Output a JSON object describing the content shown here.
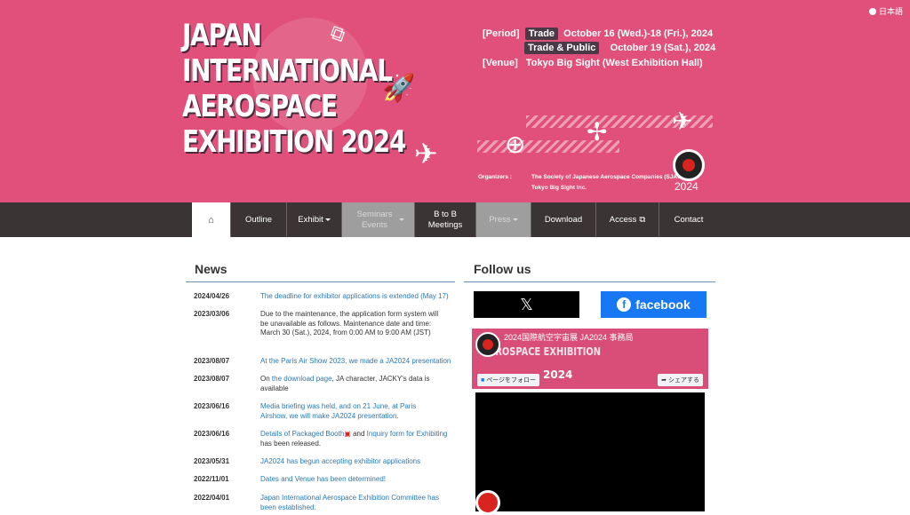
{
  "hero": {
    "language": "日本語",
    "title_lines": [
      "JAPAN",
      "INTERNATIONAL",
      "AEROSPACE",
      "EXHIBITION 2024"
    ],
    "period_label": "[Period]",
    "trade_tag": "Trade",
    "trade_dates": "October 16 (Wed.)-18 (Fri.), 2024",
    "public_tag": "Trade & Public",
    "public_date": "October 19 (Sat.), 2024",
    "venue_label": "[Venue]",
    "venue": "Tokyo Big Sight (West Exhibition Hall)",
    "organizers_label": "Organizers :",
    "organizer_1": "The Society of Japanese Aerospace Companies (SJAC)",
    "organizer_2": "Tokyo Big Sight Inc.",
    "emblem_year": "2024",
    "accent_color": "#e0507a"
  },
  "nav": {
    "items": [
      "Outline",
      "Exhibit",
      "Seminars Events",
      "B to B Meetings",
      "Press",
      "Download",
      "Access",
      "Contact"
    ]
  },
  "news": {
    "heading": "News",
    "items": [
      {
        "date": "2024/04/26",
        "text": "The deadline for exhibitor applications is extended (May 17)"
      },
      {
        "date": "2023/03/06",
        "text": "Due to the maintenance, the application form system will be unavailable as follows. Maintenance date and time: March 30 (Sat.), 2024, from 0:00 AM to 9:00 AM (JST)"
      },
      {
        "date": "2023/08/07",
        "text": "At the Paris Air Show 2023, we made a JA2024 presentation"
      },
      {
        "date": "2023/08/07",
        "text_a": "On ",
        "text_link": "the download page",
        "text_b": ", JA character, JACKY's data is available"
      },
      {
        "date": "2023/06/16",
        "text": "Media briefing was held, and on 21 June, at Paris Airshow, we will make JA2024 presentation."
      },
      {
        "date": "2023/06/16",
        "text_a": "Details of Packaged Booth",
        "text_b": " and ",
        "text_c": "Inquiry form for Exhibiting",
        "text_d": " has been released."
      },
      {
        "date": "2023/05/31",
        "text": "JA2024 has begun accepting exhibitor applications"
      },
      {
        "date": "2022/11/01",
        "text": "Dates and Venue has been determined!"
      },
      {
        "date": "2022/04/01",
        "text": "Japan International Aerospace Exhibition Committee has been established."
      }
    ]
  },
  "follow": {
    "heading": "Follow us",
    "x_label": "𝕏",
    "facebook_label": "facebook",
    "fb_page_name": "2024国際航空宇宙展 JA2024 事務局",
    "fb_follow": "ページをフォロー",
    "fb_share": "シェアする",
    "fb_banner_title": "AEROSPACE EXHIBITION",
    "fb_banner_year": "2024"
  }
}
